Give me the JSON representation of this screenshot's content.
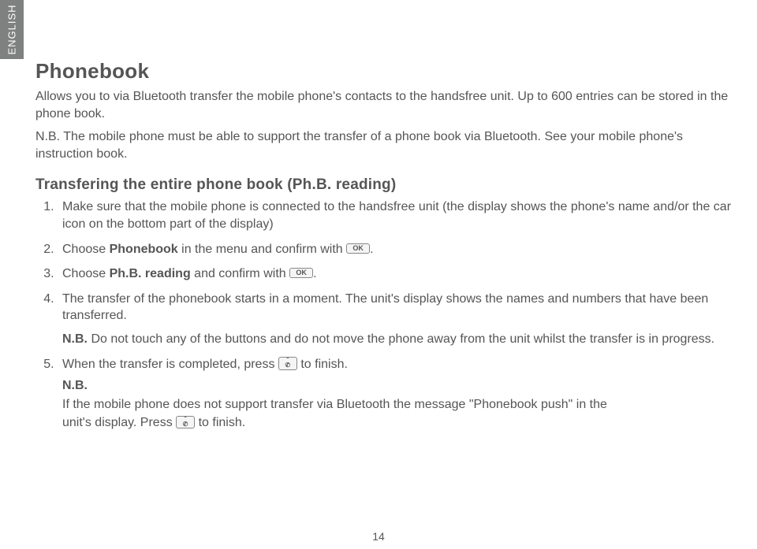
{
  "sideTab": "ENGLISH",
  "title": "Phonebook",
  "intro": "Allows you to via Bluetooth transfer the mobile phone's contacts to the handsfree unit. Up to 600 entries can be stored in the phone book.",
  "nb_intro": "N.B. The mobile phone must be able to support the transfer of a phone book via Bluetooth. See your mobile phone's instruction book.",
  "section_heading": "Transfering the entire phone book  (Ph.B. reading)",
  "steps": {
    "s1": "Make sure that the mobile phone is connected to the handsfree unit (the display shows the phone's name and/or the car icon on the bottom part of the display)",
    "s2_a": "Choose ",
    "s2_bold": "Phonebook",
    "s2_b": " in the menu and confirm with ",
    "s2_end": ".",
    "s3_a": "Choose ",
    "s3_bold": "Ph.B. reading",
    "s3_b": " and confirm with ",
    "s3_end": ".",
    "s4_main": "The transfer of the phonebook starts in a moment. The unit's display shows the names and numbers that have been transferred.",
    "s4_nb_label": "N.B.",
    "s4_nb_text": " Do not touch any of the buttons and do not move the phone away from the unit whilst the transfer is in progress.",
    "s5_a": "When the transfer is completed, press ",
    "s5_b": " to finish."
  },
  "footer": {
    "nb_label": "N.B.",
    "line1_a": "If the mobile phone does not support transfer via Bluetooth the message \"Phonebook push\" in the",
    "line2_a": "unit's display. Press ",
    "line2_b": " to finish."
  },
  "icons": {
    "ok": "OK",
    "phone_top": "⌃",
    "phone_bot": "✆"
  },
  "pageNumber": "14"
}
